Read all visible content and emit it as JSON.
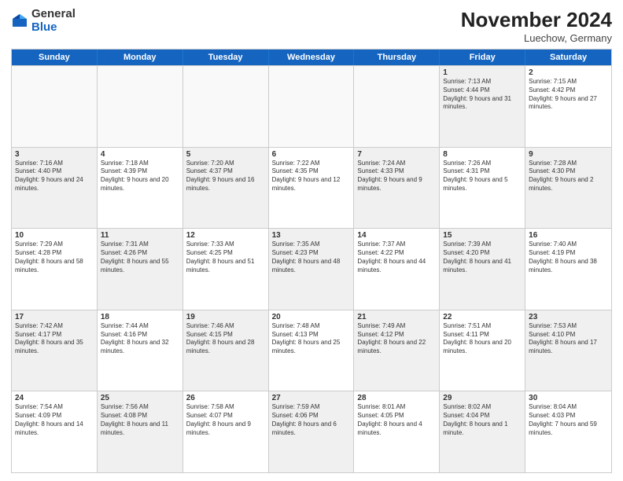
{
  "logo": {
    "general": "General",
    "blue": "Blue"
  },
  "title": "November 2024",
  "location": "Luechow, Germany",
  "days": [
    "Sunday",
    "Monday",
    "Tuesday",
    "Wednesday",
    "Thursday",
    "Friday",
    "Saturday"
  ],
  "rows": [
    [
      {
        "num": "",
        "text": "",
        "empty": true
      },
      {
        "num": "",
        "text": "",
        "empty": true
      },
      {
        "num": "",
        "text": "",
        "empty": true
      },
      {
        "num": "",
        "text": "",
        "empty": true
      },
      {
        "num": "",
        "text": "",
        "empty": true
      },
      {
        "num": "1",
        "text": "Sunrise: 7:13 AM\nSunset: 4:44 PM\nDaylight: 9 hours and 31 minutes.",
        "empty": false,
        "shaded": true
      },
      {
        "num": "2",
        "text": "Sunrise: 7:15 AM\nSunset: 4:42 PM\nDaylight: 9 hours and 27 minutes.",
        "empty": false,
        "shaded": false
      }
    ],
    [
      {
        "num": "3",
        "text": "Sunrise: 7:16 AM\nSunset: 4:40 PM\nDaylight: 9 hours and 24 minutes.",
        "empty": false,
        "shaded": true
      },
      {
        "num": "4",
        "text": "Sunrise: 7:18 AM\nSunset: 4:39 PM\nDaylight: 9 hours and 20 minutes.",
        "empty": false,
        "shaded": false
      },
      {
        "num": "5",
        "text": "Sunrise: 7:20 AM\nSunset: 4:37 PM\nDaylight: 9 hours and 16 minutes.",
        "empty": false,
        "shaded": true
      },
      {
        "num": "6",
        "text": "Sunrise: 7:22 AM\nSunset: 4:35 PM\nDaylight: 9 hours and 12 minutes.",
        "empty": false,
        "shaded": false
      },
      {
        "num": "7",
        "text": "Sunrise: 7:24 AM\nSunset: 4:33 PM\nDaylight: 9 hours and 9 minutes.",
        "empty": false,
        "shaded": true
      },
      {
        "num": "8",
        "text": "Sunrise: 7:26 AM\nSunset: 4:31 PM\nDaylight: 9 hours and 5 minutes.",
        "empty": false,
        "shaded": false
      },
      {
        "num": "9",
        "text": "Sunrise: 7:28 AM\nSunset: 4:30 PM\nDaylight: 9 hours and 2 minutes.",
        "empty": false,
        "shaded": true
      }
    ],
    [
      {
        "num": "10",
        "text": "Sunrise: 7:29 AM\nSunset: 4:28 PM\nDaylight: 8 hours and 58 minutes.",
        "empty": false,
        "shaded": false
      },
      {
        "num": "11",
        "text": "Sunrise: 7:31 AM\nSunset: 4:26 PM\nDaylight: 8 hours and 55 minutes.",
        "empty": false,
        "shaded": true
      },
      {
        "num": "12",
        "text": "Sunrise: 7:33 AM\nSunset: 4:25 PM\nDaylight: 8 hours and 51 minutes.",
        "empty": false,
        "shaded": false
      },
      {
        "num": "13",
        "text": "Sunrise: 7:35 AM\nSunset: 4:23 PM\nDaylight: 8 hours and 48 minutes.",
        "empty": false,
        "shaded": true
      },
      {
        "num": "14",
        "text": "Sunrise: 7:37 AM\nSunset: 4:22 PM\nDaylight: 8 hours and 44 minutes.",
        "empty": false,
        "shaded": false
      },
      {
        "num": "15",
        "text": "Sunrise: 7:39 AM\nSunset: 4:20 PM\nDaylight: 8 hours and 41 minutes.",
        "empty": false,
        "shaded": true
      },
      {
        "num": "16",
        "text": "Sunrise: 7:40 AM\nSunset: 4:19 PM\nDaylight: 8 hours and 38 minutes.",
        "empty": false,
        "shaded": false
      }
    ],
    [
      {
        "num": "17",
        "text": "Sunrise: 7:42 AM\nSunset: 4:17 PM\nDaylight: 8 hours and 35 minutes.",
        "empty": false,
        "shaded": true
      },
      {
        "num": "18",
        "text": "Sunrise: 7:44 AM\nSunset: 4:16 PM\nDaylight: 8 hours and 32 minutes.",
        "empty": false,
        "shaded": false
      },
      {
        "num": "19",
        "text": "Sunrise: 7:46 AM\nSunset: 4:15 PM\nDaylight: 8 hours and 28 minutes.",
        "empty": false,
        "shaded": true
      },
      {
        "num": "20",
        "text": "Sunrise: 7:48 AM\nSunset: 4:13 PM\nDaylight: 8 hours and 25 minutes.",
        "empty": false,
        "shaded": false
      },
      {
        "num": "21",
        "text": "Sunrise: 7:49 AM\nSunset: 4:12 PM\nDaylight: 8 hours and 22 minutes.",
        "empty": false,
        "shaded": true
      },
      {
        "num": "22",
        "text": "Sunrise: 7:51 AM\nSunset: 4:11 PM\nDaylight: 8 hours and 20 minutes.",
        "empty": false,
        "shaded": false
      },
      {
        "num": "23",
        "text": "Sunrise: 7:53 AM\nSunset: 4:10 PM\nDaylight: 8 hours and 17 minutes.",
        "empty": false,
        "shaded": true
      }
    ],
    [
      {
        "num": "24",
        "text": "Sunrise: 7:54 AM\nSunset: 4:09 PM\nDaylight: 8 hours and 14 minutes.",
        "empty": false,
        "shaded": false
      },
      {
        "num": "25",
        "text": "Sunrise: 7:56 AM\nSunset: 4:08 PM\nDaylight: 8 hours and 11 minutes.",
        "empty": false,
        "shaded": true
      },
      {
        "num": "26",
        "text": "Sunrise: 7:58 AM\nSunset: 4:07 PM\nDaylight: 8 hours and 9 minutes.",
        "empty": false,
        "shaded": false
      },
      {
        "num": "27",
        "text": "Sunrise: 7:59 AM\nSunset: 4:06 PM\nDaylight: 8 hours and 6 minutes.",
        "empty": false,
        "shaded": true
      },
      {
        "num": "28",
        "text": "Sunrise: 8:01 AM\nSunset: 4:05 PM\nDaylight: 8 hours and 4 minutes.",
        "empty": false,
        "shaded": false
      },
      {
        "num": "29",
        "text": "Sunrise: 8:02 AM\nSunset: 4:04 PM\nDaylight: 8 hours and 1 minute.",
        "empty": false,
        "shaded": true
      },
      {
        "num": "30",
        "text": "Sunrise: 8:04 AM\nSunset: 4:03 PM\nDaylight: 7 hours and 59 minutes.",
        "empty": false,
        "shaded": false
      }
    ]
  ]
}
